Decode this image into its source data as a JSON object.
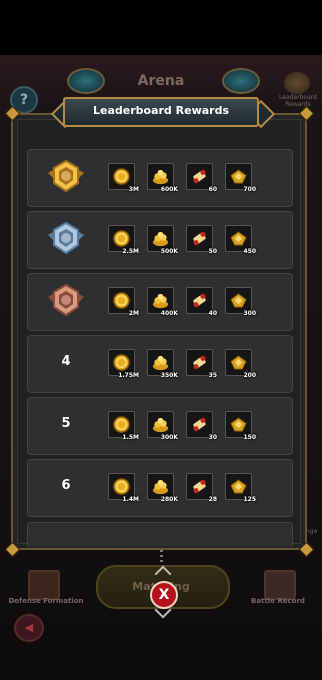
{
  "arena": {
    "title": "Arena",
    "help_label": "?",
    "leaderboard_label": "Leaderboard Rewards",
    "side_text": "nge"
  },
  "panel": {
    "title": "Leaderboard Rewards"
  },
  "rows": [
    {
      "rank": "1",
      "medal": "gold-medal",
      "gold": "3M",
      "pile": "600K",
      "scroll": "60",
      "ingot": "700"
    },
    {
      "rank": "2",
      "medal": "silver-medal",
      "gold": "2.5M",
      "pile": "500K",
      "scroll": "50",
      "ingot": "450"
    },
    {
      "rank": "3",
      "medal": "bronze-medal",
      "gold": "2M",
      "pile": "400K",
      "scroll": "40",
      "ingot": "300"
    },
    {
      "rank": "4",
      "gold": "1.75M",
      "pile": "350K",
      "scroll": "35",
      "ingot": "200"
    },
    {
      "rank": "5",
      "gold": "1.5M",
      "pile": "300K",
      "scroll": "30",
      "ingot": "150"
    },
    {
      "rank": "6",
      "gold": "1.4M",
      "pile": "280K",
      "scroll": "28",
      "ingot": "125"
    }
  ],
  "bottom": {
    "defense_label": "Defense Formation",
    "battle_label": "Battle Record",
    "match_label": "Matching",
    "close_label": "X",
    "back_label": "◀"
  },
  "colors": {
    "gold": "#e8b020",
    "frame": "#b48d43",
    "close": "#b3121b"
  }
}
